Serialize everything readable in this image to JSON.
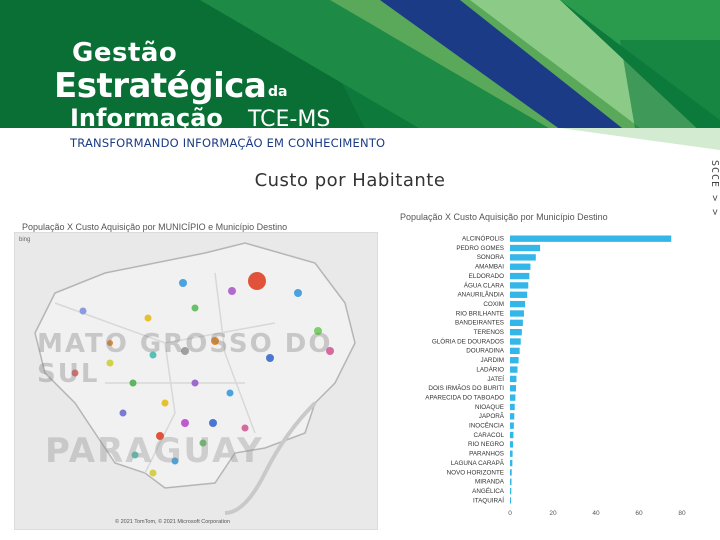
{
  "header": {
    "logo_line1": "Gestão",
    "logo_line2": "Estratégica",
    "logo_da": "da",
    "logo_line3": "Informação",
    "logo_org": "TCE-MS",
    "tagline": "TRANSFORMANDO INFORMAÇÃO EM CONHECIMENTO",
    "colors": {
      "green_dark": "#0b7a3c",
      "green_light": "#7cc07a",
      "blue": "#1b3b86"
    }
  },
  "side_toolbar": {
    "label": "SCCE > >"
  },
  "page_title": "Custo por Habitante",
  "map": {
    "title": "População X Custo Aquisição por MUNICÍPIO e Município Destino",
    "logo": "bing",
    "state_label": "MATO GROSSO DO SUL",
    "country_label": "PARAGUAY",
    "credit": "© 2021 TomTom, © 2021 Microsoft Corporation"
  },
  "chart_data": {
    "type": "bar",
    "orientation": "horizontal",
    "title": "População X Custo Aquisição por Município Destino",
    "bar_color": "#35b6e8",
    "categories": [
      "ALCINÓPOLIS",
      "PEDRO GOMES",
      "SONORA",
      "AMAMBAI",
      "ELDORADO",
      "ÁGUA CLARA",
      "ANAURILÂNDIA",
      "COXIM",
      "RIO BRILHANTE",
      "BANDEIRANTES",
      "TERENOS",
      "GLÓRIA DE DOURADOS",
      "DOURADINA",
      "JARDIM",
      "LADÁRIO",
      "JATEÍ",
      "DOIS IRMÃOS DO BURITI",
      "APARECIDA DO TABOADO",
      "NIOAQUE",
      "JAPORÃ",
      "INOCÊNCIA",
      "CARACOL",
      "RIO NEGRO",
      "PARANHOS",
      "LAGUNA CARAPÃ",
      "NOVO HORIZONTE",
      "MIRANDA",
      "ANGÉLICA",
      "ITAQUIRAÍ"
    ],
    "values": [
      75,
      14,
      12,
      9.5,
      9,
      8.5,
      8,
      7,
      6.5,
      6,
      5.5,
      5,
      4.5,
      4,
      3.5,
      3,
      2.8,
      2.5,
      2.2,
      2,
      1.8,
      1.6,
      1.4,
      1.2,
      1.1,
      0.8,
      0.7,
      0.6,
      0.5
    ],
    "x_ticks": [
      "0",
      "20",
      "40",
      "60",
      "80"
    ],
    "xlim": [
      0,
      80
    ]
  }
}
